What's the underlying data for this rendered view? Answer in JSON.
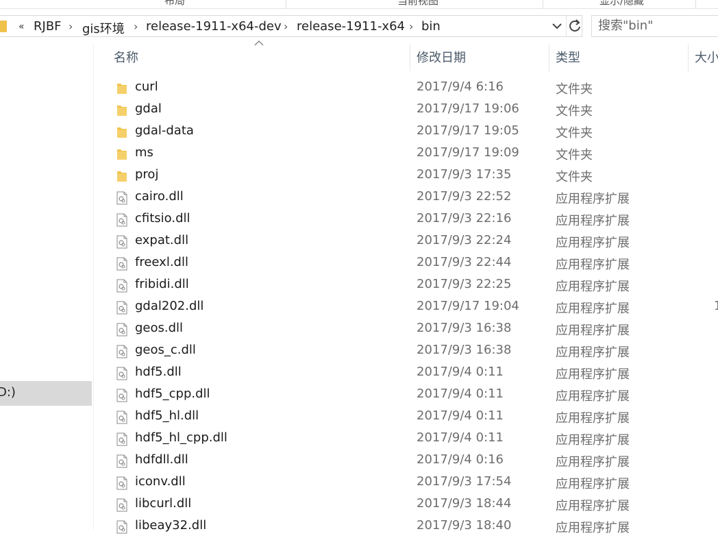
{
  "ribbon": {
    "tabs": [
      "布局",
      "当前视图",
      "显示/隐藏"
    ]
  },
  "address_bar": {
    "overflow": "«",
    "breadcrumbs": [
      "RJBF",
      "gis环境",
      "release-1911-x64-dev",
      "release-1911-x64",
      "bin"
    ]
  },
  "search": {
    "placeholder": "搜索\"bin\""
  },
  "nav": {
    "selected_label": "D:)"
  },
  "columns": {
    "name": "名称",
    "date": "修改日期",
    "type": "类型",
    "size": "大小"
  },
  "files": [
    {
      "name": "curl",
      "date": "2017/9/4 6:16",
      "type": "文件夹",
      "kind": "folder",
      "size": ""
    },
    {
      "name": "gdal",
      "date": "2017/9/17 19:06",
      "type": "文件夹",
      "kind": "folder",
      "size": ""
    },
    {
      "name": "gdal-data",
      "date": "2017/9/17 19:05",
      "type": "文件夹",
      "kind": "folder",
      "size": ""
    },
    {
      "name": "ms",
      "date": "2017/9/17 19:09",
      "type": "文件夹",
      "kind": "folder",
      "size": ""
    },
    {
      "name": "proj",
      "date": "2017/9/3 17:35",
      "type": "文件夹",
      "kind": "folder",
      "size": ""
    },
    {
      "name": "cairo.dll",
      "date": "2017/9/3 22:52",
      "type": "应用程序扩展",
      "kind": "dll",
      "size": ""
    },
    {
      "name": "cfitsio.dll",
      "date": "2017/9/3 22:16",
      "type": "应用程序扩展",
      "kind": "dll",
      "size": ""
    },
    {
      "name": "expat.dll",
      "date": "2017/9/3 22:24",
      "type": "应用程序扩展",
      "kind": "dll",
      "size": ""
    },
    {
      "name": "freexl.dll",
      "date": "2017/9/3 22:44",
      "type": "应用程序扩展",
      "kind": "dll",
      "size": ""
    },
    {
      "name": "fribidi.dll",
      "date": "2017/9/3 22:25",
      "type": "应用程序扩展",
      "kind": "dll",
      "size": ""
    },
    {
      "name": "gdal202.dll",
      "date": "2017/9/17 19:04",
      "type": "应用程序扩展",
      "kind": "dll",
      "size": "1"
    },
    {
      "name": "geos.dll",
      "date": "2017/9/3 16:38",
      "type": "应用程序扩展",
      "kind": "dll",
      "size": ""
    },
    {
      "name": "geos_c.dll",
      "date": "2017/9/3 16:38",
      "type": "应用程序扩展",
      "kind": "dll",
      "size": ""
    },
    {
      "name": "hdf5.dll",
      "date": "2017/9/4 0:11",
      "type": "应用程序扩展",
      "kind": "dll",
      "size": ""
    },
    {
      "name": "hdf5_cpp.dll",
      "date": "2017/9/4 0:11",
      "type": "应用程序扩展",
      "kind": "dll",
      "size": ""
    },
    {
      "name": "hdf5_hl.dll",
      "date": "2017/9/4 0:11",
      "type": "应用程序扩展",
      "kind": "dll",
      "size": ""
    },
    {
      "name": "hdf5_hl_cpp.dll",
      "date": "2017/9/4 0:11",
      "type": "应用程序扩展",
      "kind": "dll",
      "size": ""
    },
    {
      "name": "hdfdll.dll",
      "date": "2017/9/4 0:16",
      "type": "应用程序扩展",
      "kind": "dll",
      "size": ""
    },
    {
      "name": "iconv.dll",
      "date": "2017/9/3 17:54",
      "type": "应用程序扩展",
      "kind": "dll",
      "size": ""
    },
    {
      "name": "libcurl.dll",
      "date": "2017/9/3 18:44",
      "type": "应用程序扩展",
      "kind": "dll",
      "size": ""
    },
    {
      "name": "libeay32.dll",
      "date": "2017/9/3 18:40",
      "type": "应用程序扩展",
      "kind": "dll",
      "size": ""
    }
  ],
  "colors": {
    "folder": "#f0c24b",
    "header_text": "#4a5a6a",
    "selected_bg": "#d9d9d9"
  }
}
